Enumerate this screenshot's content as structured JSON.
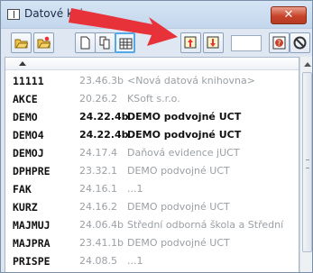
{
  "window": {
    "title": "Datové kni"
  },
  "close_label": "✕",
  "toolbar": {
    "buttons": [
      "open-folder-icon",
      "open-folder-star-icon",
      "new-doc-icon",
      "copy-doc-icon",
      "grid-icon",
      "move-up-icon",
      "move-down-icon",
      "help-icon",
      "no-entry-icon"
    ],
    "input_value": ""
  },
  "list": {
    "rows": [
      {
        "code": "11111",
        "version": "23.46.3b",
        "name": "<Nová datová knihovna>",
        "bold": false
      },
      {
        "code": "AKCE",
        "version": "20.26.2",
        "name": "KSoft s.r.o.",
        "bold": false
      },
      {
        "code": "DEMO",
        "version": "24.22.4b",
        "name": "DEMO podvojné UCT",
        "bold": true
      },
      {
        "code": "DEMO4",
        "version": "24.22.4b",
        "name": "DEMO podvojné UCT",
        "bold": true
      },
      {
        "code": "DEMOJ",
        "version": "24.17.4",
        "name": "Daňová evidence jUCT",
        "bold": false
      },
      {
        "code": "DPHPRE",
        "version": "23.32.1",
        "name": "DEMO podvojné UCT",
        "bold": false
      },
      {
        "code": "FAK",
        "version": "24.16.1",
        "name": "...1",
        "bold": false
      },
      {
        "code": "KURZ",
        "version": "24.16.2",
        "name": "DEMO podvojné UCT",
        "bold": false
      },
      {
        "code": "MAJMUJ",
        "version": "24.06.4b",
        "name": "Střední odborná škola a Střední",
        "bold": false
      },
      {
        "code": "MAJPRA",
        "version": "23.41.1b",
        "name": "DEMO podvojné UCT",
        "bold": false
      },
      {
        "code": "PRISPE",
        "version": "24.08.5",
        "name": "...1",
        "bold": false
      }
    ]
  },
  "colors": {
    "accent_arrow": "#e8323a",
    "highlight": "#55a8e8"
  }
}
